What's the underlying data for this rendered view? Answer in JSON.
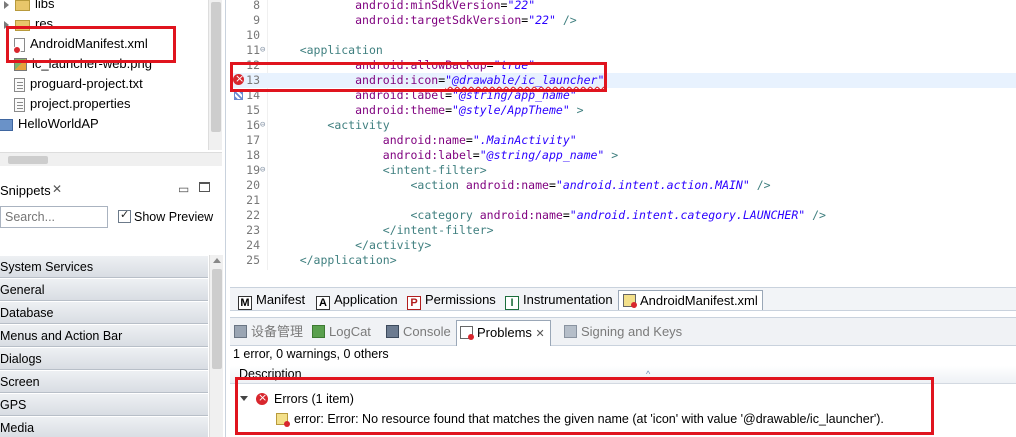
{
  "tree": {
    "items": [
      {
        "label": "libs",
        "icon": "folder-icon"
      },
      {
        "label": "res",
        "icon": "folder-icon"
      },
      {
        "label": "AndroidManifest.xml",
        "icon": "xml-file-icon"
      },
      {
        "label": "ic_launcher-web.png",
        "icon": "image-file-icon"
      },
      {
        "label": "proguard-project.txt",
        "icon": "text-file-icon"
      },
      {
        "label": "project.properties",
        "icon": "text-file-icon"
      },
      {
        "label": "HelloWorldAP",
        "icon": "project-icon"
      }
    ]
  },
  "snippets": {
    "title": "Snippets",
    "close_glyph": "✕",
    "search_placeholder": "Search...",
    "show_preview_label": "Show Preview",
    "show_preview_checked": true,
    "categories": [
      "System Services",
      "General",
      "Database",
      "Menus and Action Bar",
      "Dialogs",
      "Screen",
      "GPS",
      "Media"
    ]
  },
  "editor": {
    "lines": [
      {
        "n": "8",
        "indent": "            ",
        "attr": "android:minSdkVersion",
        "eq": "=",
        "val": "\"22\"",
        "tail": ""
      },
      {
        "n": "9",
        "indent": "            ",
        "attr": "android:targetSdkVersion",
        "eq": "=",
        "val": "\"22\"",
        "tail": " />"
      },
      {
        "n": "10",
        "indent": "",
        "attr": "",
        "eq": "",
        "val": "",
        "tail": ""
      },
      {
        "n": "11",
        "indent": "    ",
        "attr": "",
        "eq": "",
        "val": "",
        "tail": "<application"
      },
      {
        "n": "12",
        "indent": "            ",
        "attr": "android:allowBackup",
        "eq": "=",
        "val": "\"true\"",
        "tail": ""
      },
      {
        "n": "13",
        "indent": "            ",
        "attr": "android:icon",
        "eq": "=",
        "val": "\"@drawable/ic_launcher\"",
        "tail": ""
      },
      {
        "n": "14",
        "indent": "            ",
        "attr": "android:label",
        "eq": "=",
        "val": "\"@string/app_name\"",
        "tail": ""
      },
      {
        "n": "15",
        "indent": "            ",
        "attr": "android:theme",
        "eq": "=",
        "val": "\"@style/AppTheme\"",
        "tail": " >"
      },
      {
        "n": "16",
        "indent": "        ",
        "attr": "",
        "eq": "",
        "val": "",
        "tail": "<activity"
      },
      {
        "n": "17",
        "indent": "                ",
        "attr": "android:name",
        "eq": "=",
        "val": "\".MainActivity\"",
        "tail": ""
      },
      {
        "n": "18",
        "indent": "                ",
        "attr": "android:label",
        "eq": "=",
        "val": "\"@string/app_name\"",
        "tail": " >"
      },
      {
        "n": "19",
        "indent": "                ",
        "attr": "",
        "eq": "",
        "val": "",
        "tail": "<intent-filter>"
      },
      {
        "n": "20",
        "indent": "                    ",
        "attr": "<action android:name",
        "eq": "=",
        "val": "\"android.intent.action.MAIN\"",
        "tail": " />"
      },
      {
        "n": "21",
        "indent": "",
        "attr": "",
        "eq": "",
        "val": "",
        "tail": ""
      },
      {
        "n": "22",
        "indent": "                    ",
        "attr": "<category android:name",
        "eq": "=",
        "val": "\"android.intent.category.LAUNCHER\"",
        "tail": " />"
      },
      {
        "n": "23",
        "indent": "                ",
        "attr": "",
        "eq": "",
        "val": "",
        "tail": "</intent-filter>"
      },
      {
        "n": "24",
        "indent": "            ",
        "attr": "",
        "eq": "",
        "val": "",
        "tail": "</activity>"
      },
      {
        "n": "25",
        "indent": "    ",
        "attr": "",
        "eq": "",
        "val": "",
        "tail": "</application>"
      }
    ],
    "fold_glyph": "⊖"
  },
  "editor_tabs": [
    {
      "label": "Manifest",
      "letter": "M"
    },
    {
      "label": "Application",
      "letter": "A"
    },
    {
      "label": "Permissions",
      "letter": "P"
    },
    {
      "label": "Instrumentation",
      "letter": "I"
    },
    {
      "label": "AndroidManifest.xml",
      "letter": ""
    }
  ],
  "bottom_panel": {
    "tabs": [
      "设备管理",
      "LogCat",
      "Console",
      "Problems",
      "Signing and Keys"
    ],
    "active_tab": "Problems",
    "close_glyph": "✕",
    "summary": "1 error, 0 warnings, 0 others",
    "column_header": "Description",
    "sort_glyph": "^",
    "group_label": "Errors (1 item)",
    "error_text": "error: Error: No resource found that matches the given name (at 'icon' with value '@drawable/ic_launcher')."
  },
  "colors": {
    "annotation_red": "#e0141e",
    "error_red": "#d8262d",
    "attr_purple": "#7f007f",
    "string_blue": "#2a00ff",
    "tag_teal": "#3f7f7f"
  }
}
